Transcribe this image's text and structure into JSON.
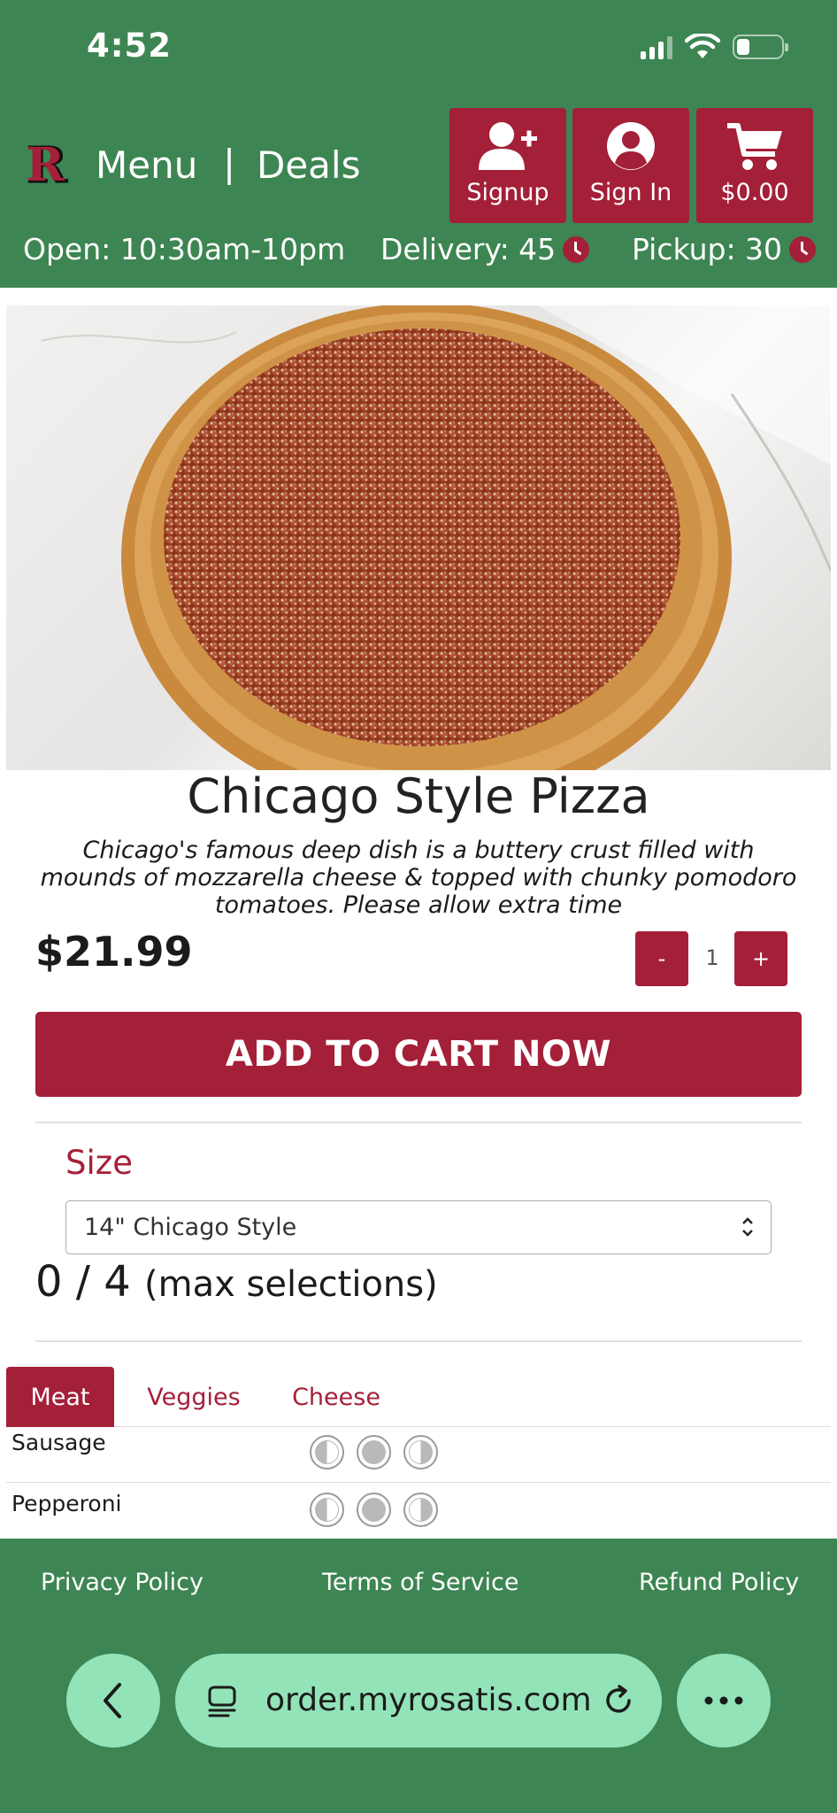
{
  "status_bar": {
    "time": "4:52"
  },
  "header": {
    "nav": {
      "menu_label": "Menu",
      "separator": "|",
      "deals_label": "Deals"
    },
    "buttons": {
      "signup": "Signup",
      "signin": "Sign In",
      "cart": "$0.00"
    },
    "info": {
      "open": "Open: 10:30am-10pm",
      "delivery": "Delivery: 45",
      "pickup": "Pickup: 30"
    }
  },
  "product": {
    "title": "Chicago Style Pizza",
    "description": "Chicago's famous deep dish is a buttery crust filled with mounds of mozzarella cheese & topped with chunky pomodoro tomatoes. Please allow extra time",
    "price": "$21.99",
    "quantity": {
      "minus": "-",
      "value": "1",
      "plus": "+"
    },
    "add_to_cart": "ADD TO CART NOW"
  },
  "options": {
    "size_label": "Size",
    "size_selected": "14\" Chicago Style",
    "max_selections": {
      "count": "0 / 4",
      "label": "(max selections)"
    },
    "tabs": [
      {
        "label": "Meat",
        "active": true
      },
      {
        "label": "Veggies",
        "active": false
      },
      {
        "label": "Cheese",
        "active": false
      }
    ],
    "toppings": [
      {
        "name": "Sausage"
      },
      {
        "name": "Pepperoni"
      }
    ]
  },
  "footer": {
    "privacy": "Privacy Policy",
    "terms": "Terms of Service",
    "refund": "Refund Policy"
  },
  "browser": {
    "url": "order.myrosatis.com"
  },
  "colors": {
    "brand_green": "#3d8552",
    "brand_red": "#a41f38",
    "browser_pill": "#93e3b9"
  }
}
